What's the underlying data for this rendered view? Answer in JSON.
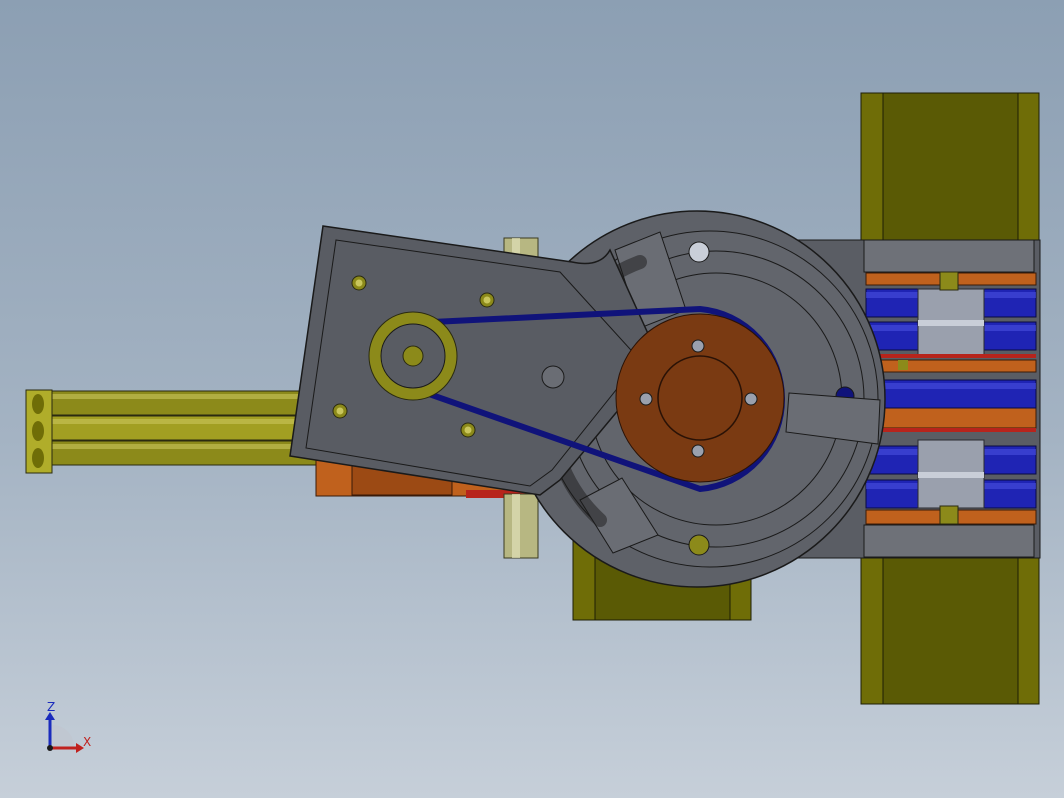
{
  "viewport": {
    "type": "cad-3d-viewport",
    "view": "top"
  },
  "triad": {
    "z_label": "Z",
    "x_label": "X",
    "z_color": "#1a2bbd",
    "x_color": "#c0211e"
  },
  "colors": {
    "background_top": "#8c9fb3",
    "background_bottom": "#c6cfd9",
    "housing": "#585b62",
    "olive": "#6f6d07",
    "copper": "#7a3a12",
    "belt": "#10137a",
    "blue_gear": "#1f24b4",
    "orange_part": "#c0611d"
  }
}
